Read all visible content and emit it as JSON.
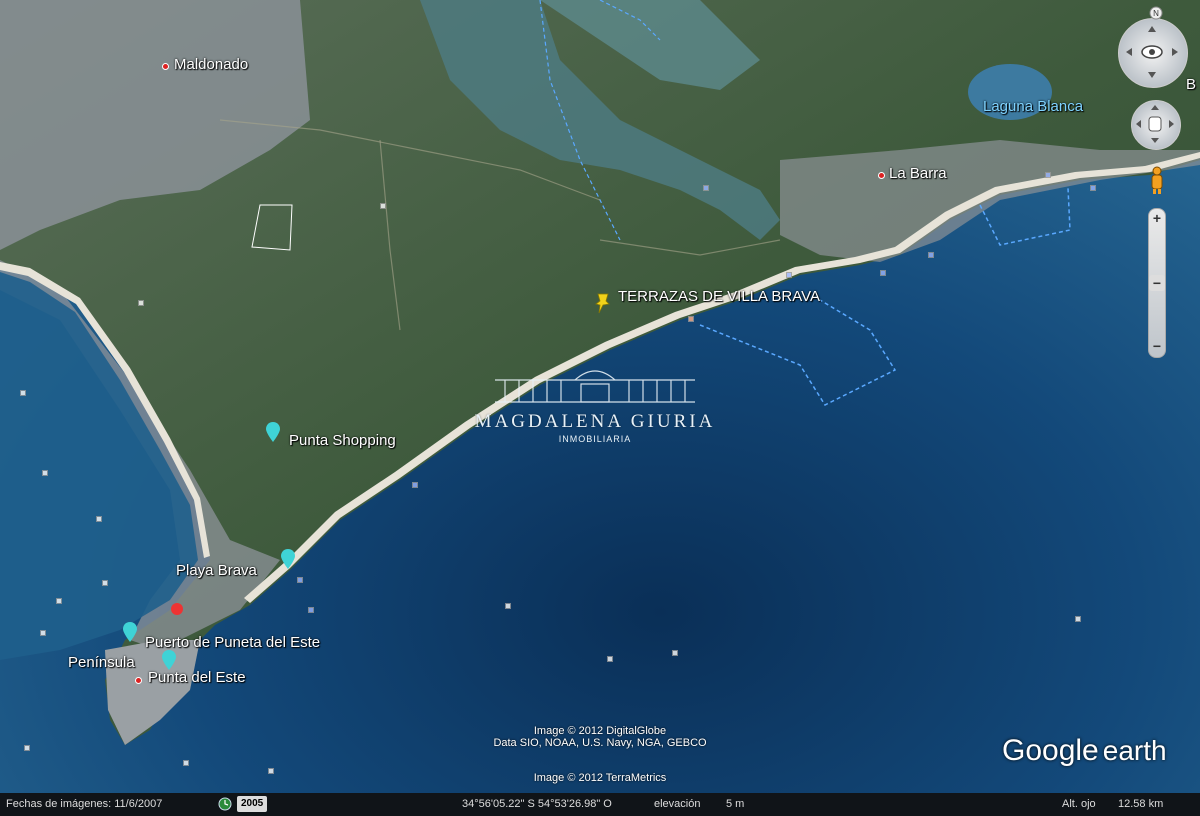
{
  "places": {
    "maldonado": "Maldonado",
    "laguna_blanca": "Laguna Blanca",
    "la_barra": "La Barra",
    "terrazas": "TERRAZAS DE VILLA BRAVA",
    "punta_shopping": "Punta Shopping",
    "playa_brava": "Playa Brava",
    "puerto": "Puerto de Puneta del Este",
    "peninsula": "Península",
    "punta_del_este": "Punta del Este"
  },
  "watermark": {
    "name": "MAGDALENA GIURIA",
    "subtitle": "INMOBILIARIA"
  },
  "credits": {
    "line1": "Image © 2012 DigitalGlobe",
    "line2": "Data SIO, NOAA, U.S. Navy, NGA, GEBCO",
    "line3": "Image © 2012 TerraMetrics"
  },
  "brand": {
    "google": "Google",
    "earth": "earth"
  },
  "statusbar": {
    "imagery_date": "Fechas de imágenes: 11/6/2007",
    "year": "2005",
    "coordinates": "34°56'05.22\" S  54°53'26.98\" O",
    "elevation_label": "elevación",
    "elevation_value": "5 m",
    "eye_alt_label": "Alt. ojo",
    "eye_alt_value": "12.58 km"
  },
  "partial_label": "B",
  "colors": {
    "ocean_deep": "#0b2c4a",
    "ocean_mid": "#1a5a88",
    "land": "#3d5a3a",
    "urban": "#8c939a",
    "beach": "#e6e2d6",
    "pin_cyan": "#3fd3d6",
    "pin_yellow": "#f1d21a",
    "boundary": "#5aa8ff"
  }
}
